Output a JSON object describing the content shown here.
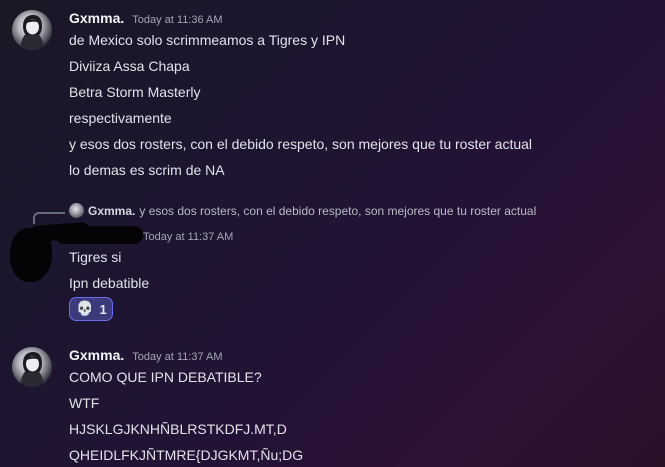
{
  "messages": [
    {
      "username": "Gxmma.",
      "timestamp": "Today at 11:36 AM",
      "lines": [
        "de Mexico solo scrimmeamos a Tigres y IPN",
        "Diviiza Assa Chapa",
        "Betra Storm Masterly",
        "respectivamente",
        "y esos dos rosters, con el debido respeto, son mejores que tu roster actual",
        "lo demas es scrim de NA"
      ]
    },
    {
      "reply": {
        "username": "Gxmma.",
        "text": "y esos dos rosters, con el debido respeto, son mejores que tu roster actual"
      },
      "timestamp": "Today at 11:37 AM",
      "lines": [
        "Tigres si",
        "Ipn debatible"
      ],
      "reaction": {
        "emoji": "💀",
        "icon": "skull-icon",
        "count": "1"
      }
    },
    {
      "username": "Gxmma.",
      "timestamp": "Today at 11:37 AM",
      "lines": [
        "COMO QUE IPN DEBATIBLE?",
        "WTF",
        "HJSKLGJKNHÑBLRSTKDFJ.MT,D",
        "QHEIDLFKJÑTMRE{DJGKMT,Ñu;DG"
      ]
    }
  ],
  "colors": {
    "background_start": "#1a1726",
    "background_end": "#2e1233",
    "reaction_border": "#6d6cf0",
    "reaction_fill": "#3b3a7a"
  }
}
